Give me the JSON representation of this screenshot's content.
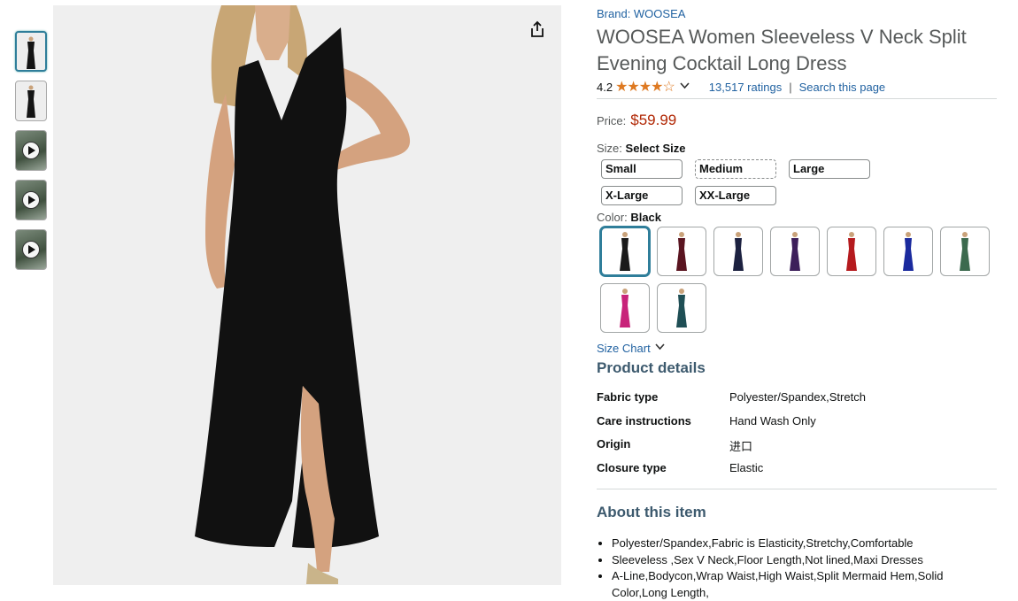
{
  "product": {
    "brand": "Brand: WOOSEA",
    "title": "WOOSEA Women Sleeveless V Neck Split Evening Cocktail Long Dress",
    "rating_value": "4.2",
    "rating_stars": 4.2,
    "ratings_count": "13,517 ratings",
    "search_link": "Search this page",
    "separator": "|",
    "price_label": "Price:",
    "price": "$59.99"
  },
  "size": {
    "label": "Size:",
    "selected": "Select Size",
    "options": [
      "Small",
      "Medium",
      "Large",
      "X-Large",
      "XX-Large"
    ]
  },
  "color": {
    "label": "Color:",
    "selected": "Black",
    "swatches": [
      "#1a1a1a",
      "#5a1420",
      "#1c2140",
      "#3d1f5a",
      "#b51a1e",
      "#1a2a9e",
      "#3c6a4e",
      "#c8237a",
      "#1f4f55"
    ]
  },
  "size_chart": "Size Chart",
  "details": {
    "heading": "Product details",
    "rows": [
      {
        "k": "Fabric type",
        "v": "Polyester/Spandex,Stretch"
      },
      {
        "k": "Care instructions",
        "v": "Hand Wash Only"
      },
      {
        "k": "Origin",
        "v": "进口"
      },
      {
        "k": "Closure type",
        "v": "Elastic"
      }
    ]
  },
  "about": {
    "heading": "About this item",
    "bullets": [
      "Polyester/Spandex,Fabric is Elasticity,Stretchy,Comfortable",
      "Sleeveless ,Sex V Neck,Floor Length,Not lined,Maxi Dresses",
      "A-Line,Bodycon,Wrap Waist,High Waist,Split Mermaid Hem,Solid Color,Long Length,"
    ]
  },
  "icons": {
    "share": "share-icon",
    "play": "play-icon",
    "chevron": "chevron-down-icon"
  },
  "colors": {
    "link": "#2162a1",
    "price": "#b12704",
    "star": "#de7921",
    "heading": "#3d5a6e",
    "selected_border": "#2f7e9a"
  }
}
